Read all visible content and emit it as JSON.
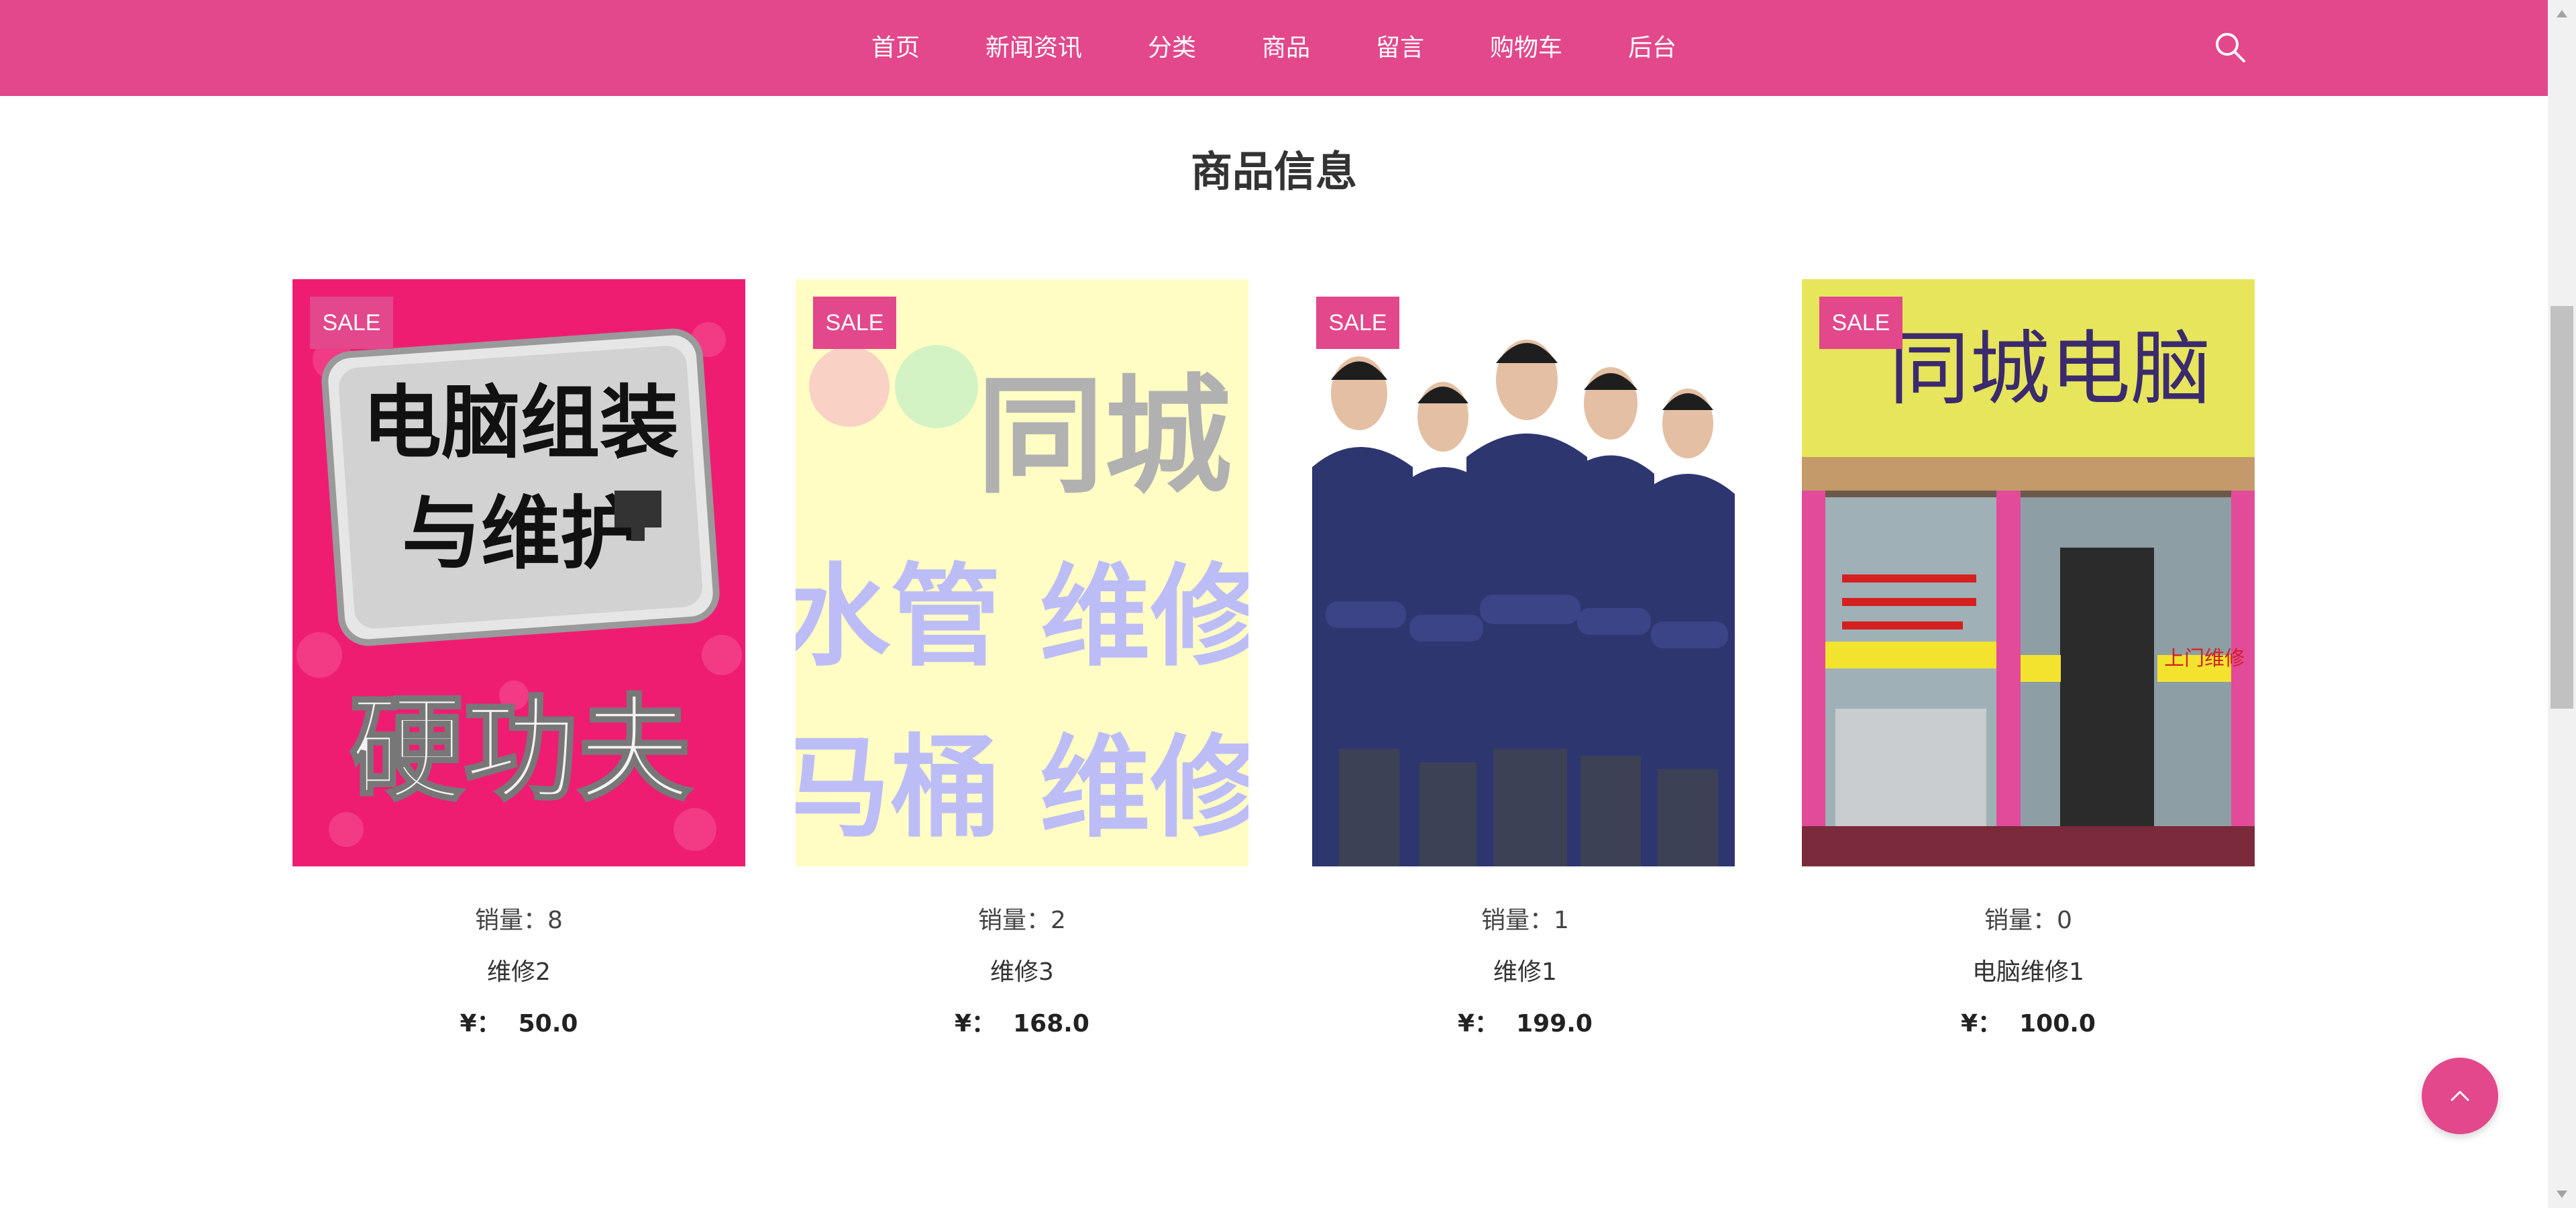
{
  "nav": {
    "items": [
      {
        "label": "首页"
      },
      {
        "label": "新闻资讯"
      },
      {
        "label": "分类"
      },
      {
        "label": "商品"
      },
      {
        "label": "留言"
      },
      {
        "label": "购物车"
      },
      {
        "label": "后台"
      }
    ],
    "search_icon": "search-icon"
  },
  "section": {
    "title": "商品信息"
  },
  "products": [
    {
      "badge": "SALE",
      "sales_label": "销量：",
      "sales": "8",
      "name": "维修2",
      "currency": "¥：",
      "price": "50.0",
      "image_text": [
        "电脑组装",
        "与维护",
        "硬功夫"
      ]
    },
    {
      "badge": "SALE",
      "sales_label": "销量：",
      "sales": "2",
      "name": "维修3",
      "currency": "¥：",
      "price": "168.0",
      "image_text": [
        "同城",
        "水管 维修",
        "马桶 维修"
      ]
    },
    {
      "badge": "SALE",
      "sales_label": "销量：",
      "sales": "1",
      "name": "维修1",
      "currency": "¥：",
      "price": "199.0"
    },
    {
      "badge": "SALE",
      "sales_label": "销量：",
      "sales": "0",
      "name": "电脑维修1",
      "currency": "¥：",
      "price": "100.0",
      "image_text": [
        "同城电脑",
        "上门维修"
      ]
    }
  ],
  "back_to_top_icon": "chevron-up-icon",
  "colors": {
    "brand": "#e2488b",
    "text": "#333333"
  }
}
